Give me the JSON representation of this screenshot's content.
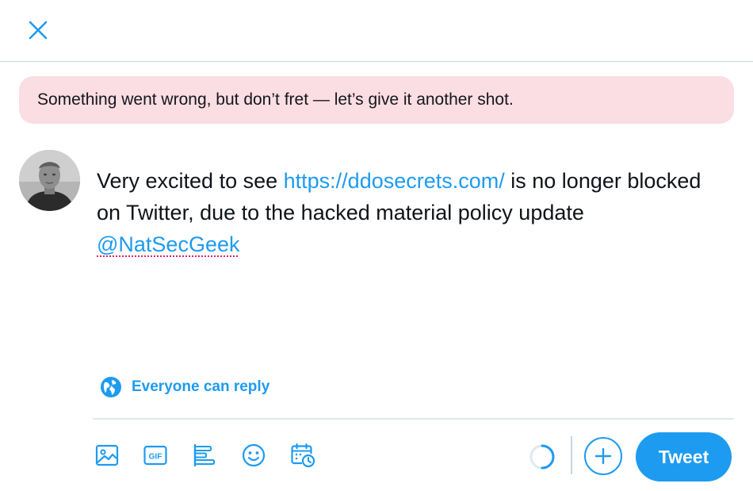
{
  "header": {
    "close_icon": "close-icon"
  },
  "error_banner": {
    "message": "Something went wrong, but don’t fret — let’s give it another shot."
  },
  "composer": {
    "text_before_link": "Very excited to see ",
    "link": "https://ddosecrets.com/",
    "text_after_link": " is no longer blocked on Twitter, due to the hacked material policy update ",
    "mention": "@NatSecGeek"
  },
  "reply_setting": {
    "label": "Everyone can reply",
    "icon": "globe-icon"
  },
  "toolbar": {
    "icons": [
      "image-icon",
      "gif-icon",
      "poll-icon",
      "emoji-icon",
      "schedule-icon"
    ],
    "gif_text": "GIF",
    "tweet_label": "Tweet",
    "add_icon": "plus-icon"
  },
  "colors": {
    "accent": "#1d9bf0",
    "error_bg": "#fbdde4",
    "divider": "#e1e8ed"
  }
}
